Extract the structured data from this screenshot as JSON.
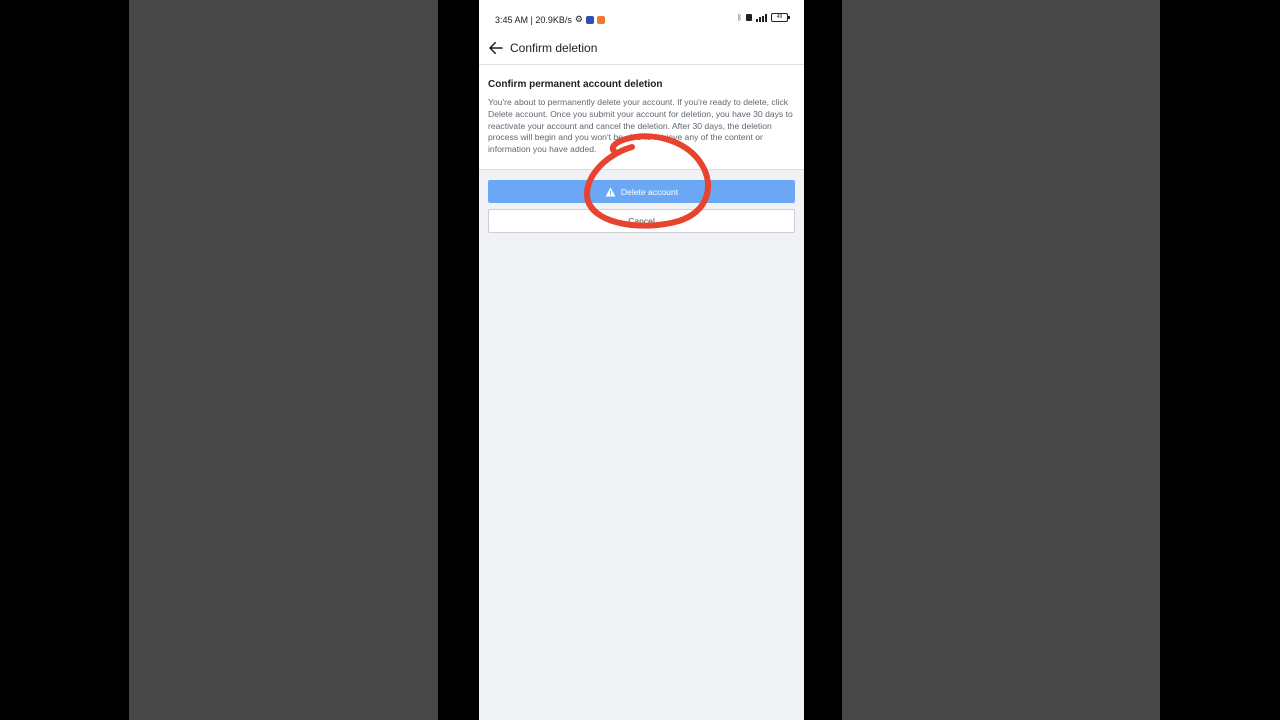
{
  "status_bar": {
    "time_speed": "3:45 AM | 20.9KB/s",
    "battery_level": "49"
  },
  "header": {
    "title": "Confirm deletion",
    "back_icon": "arrow-left-icon"
  },
  "info": {
    "title": "Confirm permanent account deletion",
    "body": "You're about to permanently delete your account. If you're ready to delete, click Delete account. Once you submit your account for deletion, you have 30 days to reactivate your account and cancel the deletion. After 30 days, the deletion process will begin and you won't be able to retrieve any of the content or information you have added."
  },
  "actions": {
    "delete_label": "Delete account",
    "delete_icon": "warning-triangle-icon",
    "cancel_label": "Cancel"
  },
  "colors": {
    "delete_button": "#6aa8f6",
    "annotation": "#e8432e",
    "page_background": "#f0f2f5"
  }
}
